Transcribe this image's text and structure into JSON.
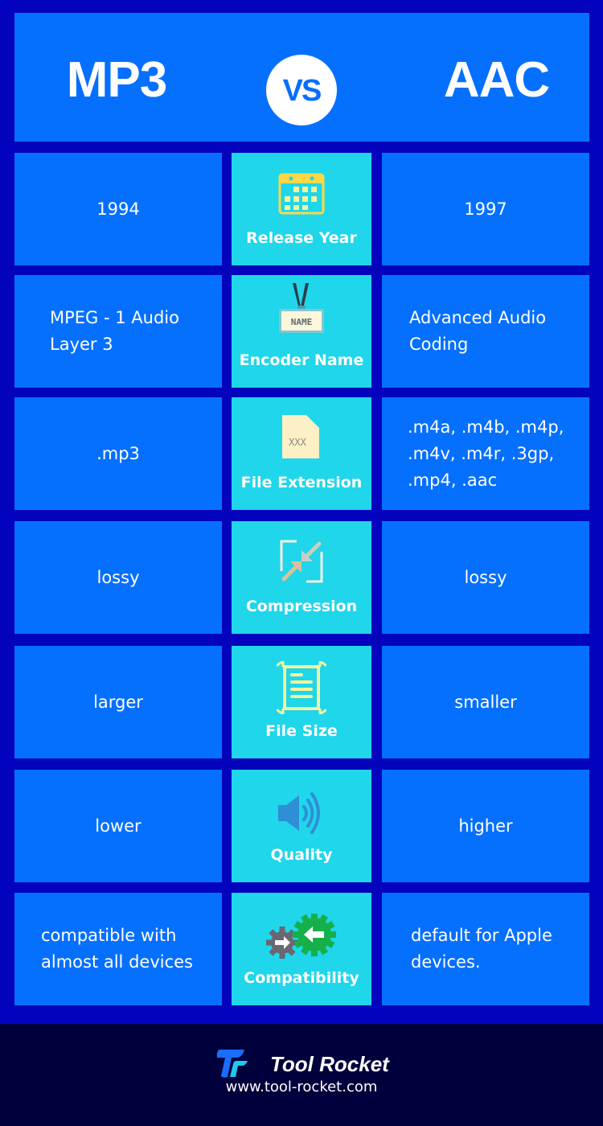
{
  "header": {
    "left_title": "MP3",
    "vs_label": "VS",
    "right_title": "AAC"
  },
  "rows": [
    {
      "left": "1994",
      "label": "Release Year",
      "icon": "calendar-icon",
      "right": "1997"
    },
    {
      "left": "MPEG - 1 Audio Layer 3",
      "label": "Encoder Name",
      "icon": "name-badge-icon",
      "icon_text": "NAME",
      "right": "Advanced Audio Coding"
    },
    {
      "left": ".mp3",
      "label": "File Extension",
      "icon": "file-icon",
      "icon_text": "XXX",
      "right": ".m4a, .m4b, .m4p, .m4v, .m4r, .3gp, .mp4, .aac"
    },
    {
      "left": "lossy",
      "label": "Compression",
      "icon": "compress-icon",
      "right": "lossy"
    },
    {
      "left": "larger",
      "label": "File Size",
      "icon": "document-size-icon",
      "right": "smaller"
    },
    {
      "left": "lower",
      "label": "Quality",
      "icon": "speaker-icon",
      "right": "higher"
    },
    {
      "left": "compatible with almost all devices",
      "label": "Compatibility",
      "icon": "gears-icon",
      "right": "default for Apple devices."
    }
  ],
  "footer": {
    "brand": "Tool Rocket",
    "website": "www.tool-rocket.com"
  },
  "colors": {
    "background": "#0303bd",
    "cell": "#0670fe",
    "label_cell": "#1fd6ea",
    "footer": "#00003c"
  }
}
